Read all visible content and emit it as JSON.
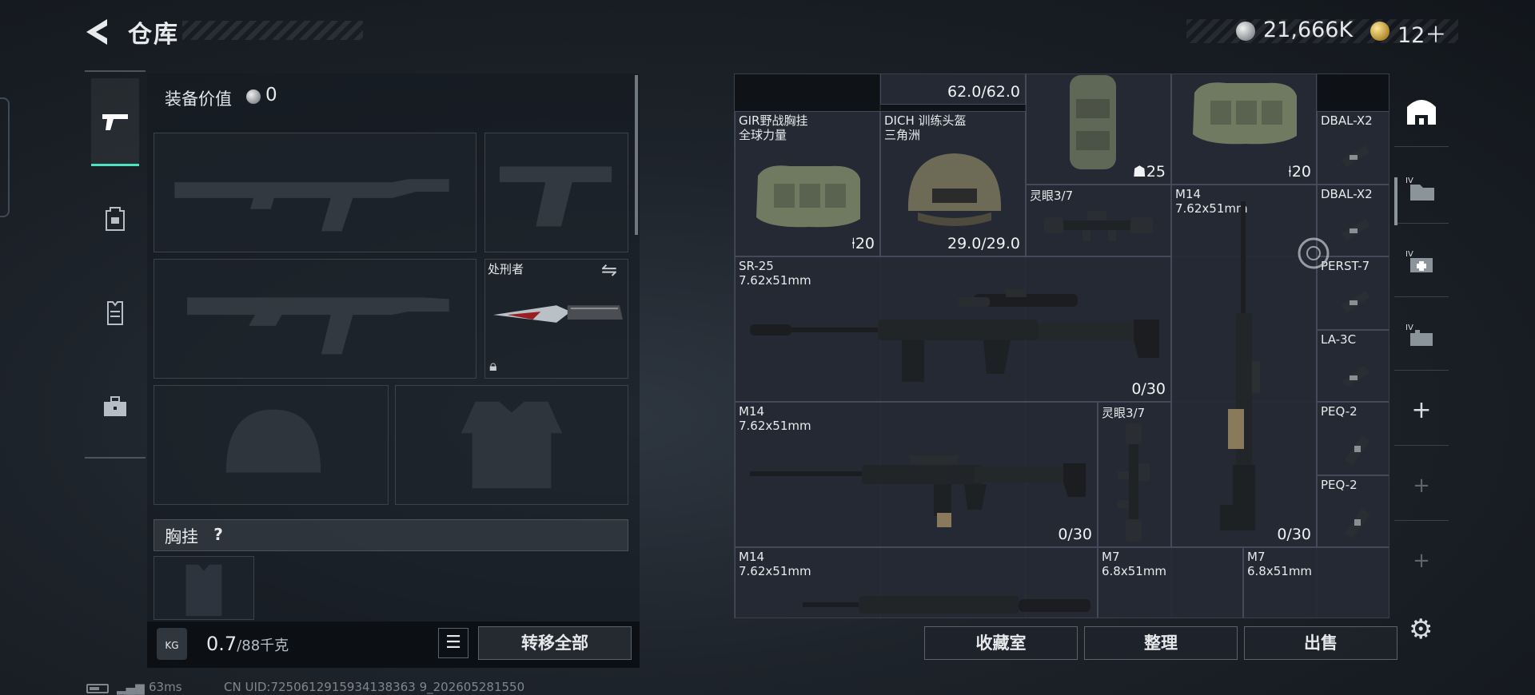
{
  "header": {
    "title": "仓库",
    "back_icon": "back-arrow-icon"
  },
  "currency": {
    "silver_value": "21,666K",
    "gold_value": "12＋",
    "silver_icon": "silver-coin-icon",
    "gold_icon": "gold-coin-icon"
  },
  "left_nav": {
    "items": [
      {
        "name": "weapons",
        "icon": "pistol-icon",
        "active": true
      },
      {
        "name": "backpack",
        "icon": "backpack-icon",
        "active": false
      },
      {
        "name": "vest",
        "icon": "vest-icon",
        "active": false
      },
      {
        "name": "case",
        "icon": "briefcase-icon",
        "active": false
      }
    ]
  },
  "loadout": {
    "equip_value_label": "装备价值",
    "equip_value": "0",
    "knife_name": "处刑者",
    "chest_label": "胸挂",
    "chest_help": "?"
  },
  "bottom_left": {
    "weight_icon_text": "KG",
    "weight_current": "0.7",
    "weight_max": "/88千克",
    "transfer_all": "转移全部"
  },
  "grid_items": {
    "top_capacity": "62.0/62.0",
    "gir_name": "GIR野战胸挂\n全球力量",
    "gir_count": "20",
    "helmet_name": "DICH 训练头盔\n三角洲",
    "helmet_durability": "29.0/29.0",
    "bag_count": "25",
    "bag2_count": "20",
    "scope1_name": "灵眼3/7",
    "m14_tall_name": "M14\n7.62x51mm",
    "m14_tall_ammo": "0/30",
    "sr25_name": "SR-25\n7.62x51mm",
    "sr25_ammo": "0/30",
    "m14_name": "M14\n7.62x51mm",
    "m14_ammo": "0/30",
    "scope2_name": "灵眼3/7",
    "m14_b_name": "M14\n7.62x51mm",
    "m7_a_name": "M7\n6.8x51mm",
    "m7_b_name": "M7\n6.8x51mm",
    "attachments": [
      "DBAL-X2",
      "DBAL-X2",
      "PERST-7",
      "LA-3C",
      "PEQ-2",
      "PEQ-2"
    ]
  },
  "right_sidebar": {
    "items": [
      "storage-icon",
      "folder-iv-icon",
      "medkit-iv-icon",
      "ammo-iv-icon",
      "plus-icon",
      "plus-icon",
      "plus-icon"
    ],
    "plus_glyph": "+",
    "settings_icon": "gear-icon"
  },
  "bottom_right": {
    "collection": "收藏室",
    "organize": "整理",
    "sell": "出售"
  },
  "status": {
    "ping": "63ms",
    "uid": "CN UID:7250612915934138363 9_202605281550"
  },
  "colors": {
    "accent": "#4fe2c0",
    "item_bg": "#2a2e3a",
    "panel_bg": "#0e1116"
  }
}
